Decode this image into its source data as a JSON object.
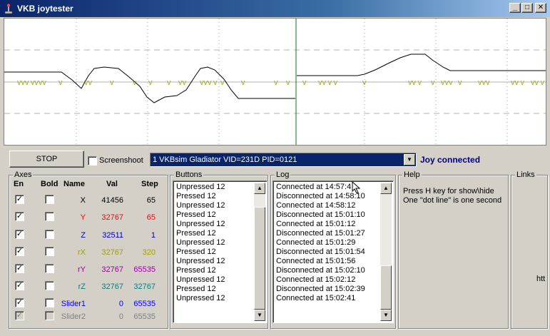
{
  "window": {
    "title": "VKB joytester"
  },
  "toolbar": {
    "stop_label": "STOP",
    "screenshoot_label": "Screenshoot",
    "device_value": "1 VKBsim Gladiator  VID=231D PID=0121",
    "status_text": "Joy connected",
    "status_color": "#000080"
  },
  "axes": {
    "title": "Axes",
    "headers": {
      "en": "En",
      "bold": "Bold",
      "name": "Name",
      "val": "Val",
      "step": "Step"
    },
    "rows": [
      {
        "name": "X",
        "val": "41456",
        "step": "65",
        "color": "#000000",
        "en": true,
        "bold": false,
        "enabled": true
      },
      {
        "name": "Y",
        "val": "32767",
        "step": "65",
        "color": "#ff0000",
        "en": true,
        "bold": false,
        "enabled": true
      },
      {
        "name": "Z",
        "val": "32511",
        "step": "1",
        "color": "#0000c0",
        "en": true,
        "bold": false,
        "enabled": true
      },
      {
        "name": "rX",
        "val": "32767",
        "step": "320",
        "color": "#a0a000",
        "en": true,
        "bold": false,
        "enabled": true
      },
      {
        "name": "rY",
        "val": "32767",
        "step": "65535",
        "color": "#a000a0",
        "en": true,
        "bold": false,
        "enabled": true
      },
      {
        "name": "rZ",
        "val": "32767",
        "step": "32767",
        "color": "#008080",
        "en": true,
        "bold": false,
        "enabled": true
      },
      {
        "name": "Slider1",
        "val": "0",
        "step": "65535",
        "color": "#0000ff",
        "en": true,
        "bold": false,
        "enabled": true
      },
      {
        "name": "Slider2",
        "val": "0",
        "step": "65535",
        "color": "#808080",
        "en": true,
        "bold": false,
        "enabled": false
      }
    ]
  },
  "buttons_panel": {
    "title": "Buttons",
    "items": [
      "Unpressed 12",
      "Pressed 12",
      "Unpressed 12",
      "Pressed 12",
      "Unpressed 12",
      "Pressed 12",
      "Unpressed 12",
      "Pressed 12",
      "Unpressed 12",
      "Pressed 12",
      "Unpressed 12",
      "Pressed 12",
      "Unpressed 12"
    ]
  },
  "log_panel": {
    "title": "Log",
    "items": [
      "Connected at 14:57:4",
      "Disconnected at 14:58:10",
      "Connected at 14:58:12",
      "Disconnected at 15:01:10",
      "Connected at 15:01:12",
      "Disconnected at 15:01:27",
      "Connected at 15:01:29",
      "Disconnected at 15:01:54",
      "Connected at 15:01:56",
      "Disconnected at 15:02:10",
      "Connected at 15:02:12",
      "Disconnected at 15:02:39",
      "Connected at 15:02:41"
    ]
  },
  "help_panel": {
    "title": "Help",
    "lines": [
      "Press H key for show\\hide",
      "One \"dot line\" is one second"
    ]
  },
  "links_panel": {
    "title": "Links",
    "text": "htt"
  },
  "colors": {
    "titlebar": "#0a246a",
    "plot_trace": "#000000",
    "cursor_line": "#008000",
    "markers": "#a0a000"
  }
}
